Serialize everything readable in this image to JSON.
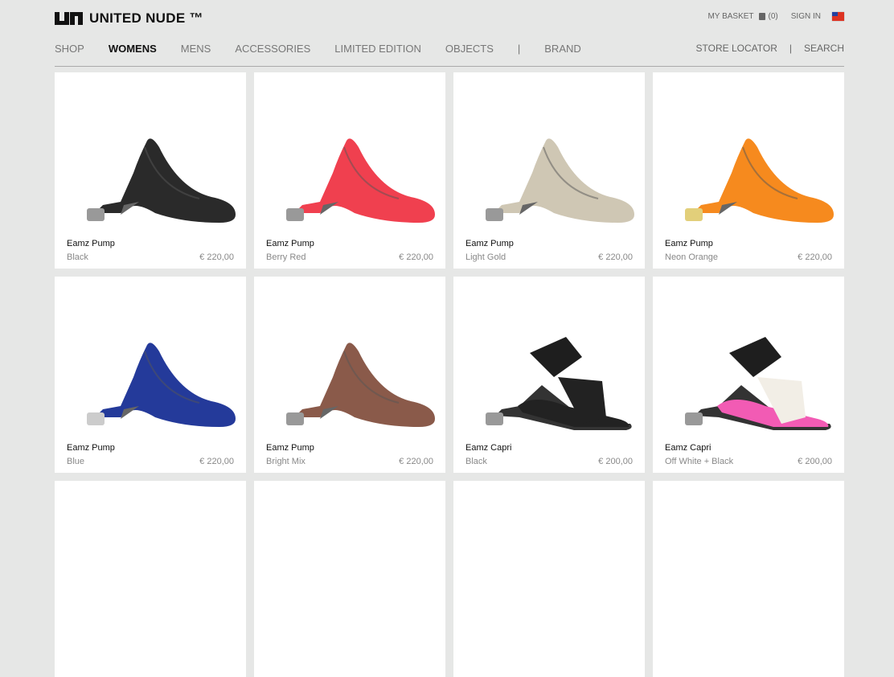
{
  "brand": {
    "name": "UNITED NUDE ™"
  },
  "top": {
    "basket": "MY BASKET",
    "basket_count": "(0)",
    "sign_in": "SIGN IN"
  },
  "nav": [
    "SHOP",
    "WOMENS",
    "MENS",
    "ACCESSORIES",
    "LIMITED EDITION",
    "OBJECTS",
    "|",
    "BRAND"
  ],
  "nav_right": {
    "store_locator": "STORE LOCATOR",
    "sep": "|",
    "search": "SEARCH"
  },
  "products": [
    {
      "name": "Eamz Pump",
      "color": "Black",
      "price": "€ 220,00",
      "type": "pump",
      "hex": "#2a2a2a",
      "heel": "#999"
    },
    {
      "name": "Eamz Pump",
      "color": "Berry Red",
      "price": "€ 220,00",
      "type": "pump",
      "hex": "#f0404f",
      "heel": "#999"
    },
    {
      "name": "Eamz Pump",
      "color": "Light Gold",
      "price": "€ 220,00",
      "type": "pump",
      "hex": "#cfc7b4",
      "heel": "#999"
    },
    {
      "name": "Eamz Pump",
      "color": "Neon Orange",
      "price": "€ 220,00",
      "type": "pump",
      "hex": "#f68a1e",
      "heel": "#e2cf7a"
    },
    {
      "name": "Eamz Pump",
      "color": "Blue",
      "price": "€ 220,00",
      "type": "pump",
      "hex": "#243a9a",
      "heel": "#ccc"
    },
    {
      "name": "Eamz Pump",
      "color": "Bright Mix",
      "price": "€ 220,00",
      "type": "pump",
      "hex": "#8a5a4a",
      "heel": "#999"
    },
    {
      "name": "Eamz Capri",
      "color": "Black",
      "price": "€ 200,00",
      "type": "sandal",
      "hex": "#222",
      "heel": "#999"
    },
    {
      "name": "Eamz Capri",
      "color": "Off White + Black",
      "price": "€ 200,00",
      "type": "sandal",
      "hex": "#f25bb4",
      "heel": "#999"
    }
  ]
}
